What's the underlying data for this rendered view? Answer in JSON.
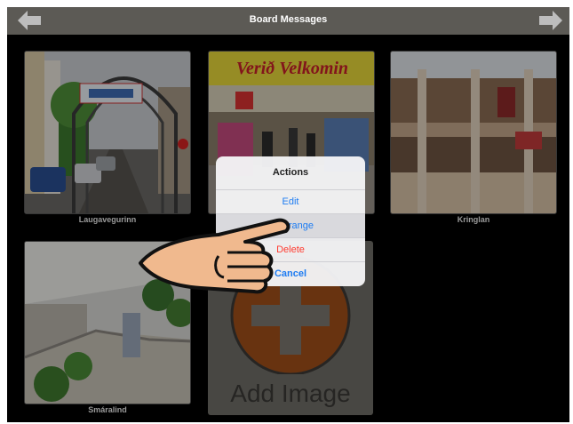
{
  "header": {
    "title": "Board Messages",
    "left_icon": "back-arrow-icon",
    "right_icon": "forward-arrow-icon"
  },
  "tiles": [
    {
      "caption": "Laugavegurinn"
    },
    {
      "caption": ""
    },
    {
      "caption": "Kringlan"
    },
    {
      "caption": "Smáralind"
    }
  ],
  "photo_signage": {
    "welcome_sign": "Verið Velkomin"
  },
  "add_tile": {
    "label": "Add Image",
    "icon": "plus-icon"
  },
  "action_sheet": {
    "title": "Actions",
    "items": [
      {
        "label": "Edit"
      },
      {
        "label": "Rearrange"
      },
      {
        "label": "Delete"
      }
    ],
    "cancel_label": "Cancel"
  },
  "colors": {
    "topbar": "#5c5a55",
    "accent": "#1d7cf2",
    "destructive": "#ff3b30",
    "add_circle": "#a04f1a"
  }
}
